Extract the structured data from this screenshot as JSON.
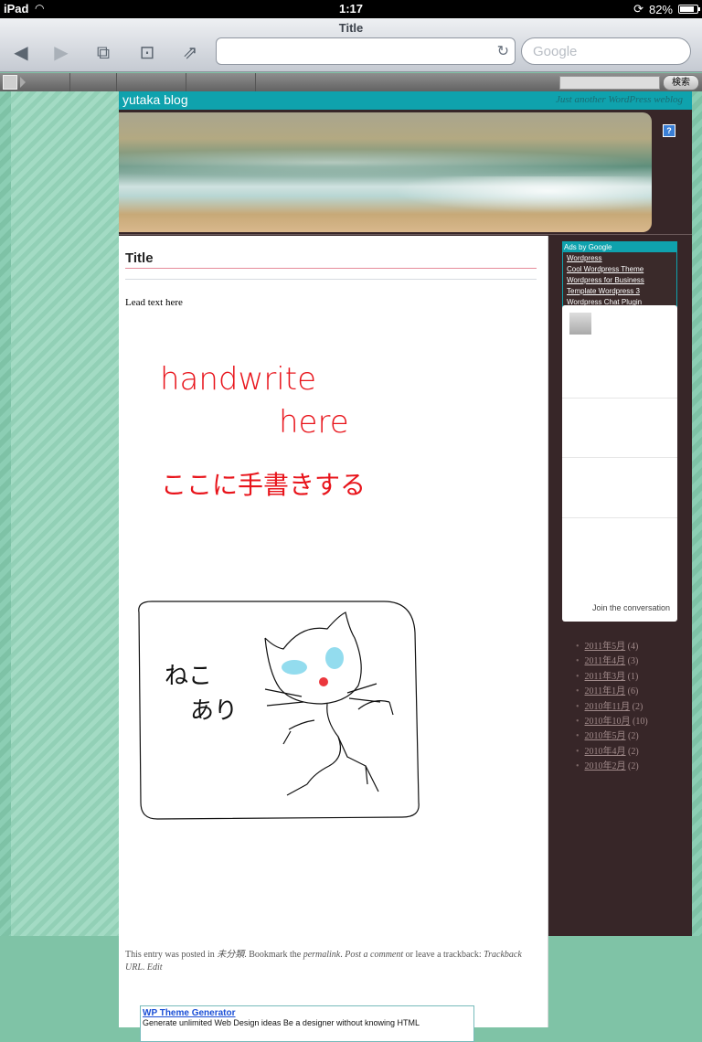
{
  "status_bar": {
    "device": "iPad",
    "time": "1:17",
    "battery": "82%",
    "battery_level": 0.82
  },
  "browser": {
    "title": "Title",
    "url": "",
    "search_placeholder": "Google"
  },
  "admin_bar": {
    "search_button": "検索"
  },
  "blog": {
    "title": "yutaka blog",
    "tagline": "Just another WordPress weblog"
  },
  "post": {
    "title": "Title",
    "lead": "Lead text here",
    "handwriting": {
      "line1": "handwrite",
      "line2": "here",
      "line3": "ここに手書きする",
      "cat_note": [
        "ねこ",
        "あり"
      ]
    },
    "meta": {
      "prefix": "This entry was posted in ",
      "category": "未分類",
      "mid1": ". Bookmark the ",
      "permalink": "permalink",
      "mid2": ". ",
      "post_comment": "Post a comment",
      "mid3": " or leave a trackback: ",
      "trackback": "Trackback URL",
      "mid4": ". ",
      "edit": "Edit"
    }
  },
  "wp_box": {
    "link": "WP Theme Generator",
    "desc": "Generate unlimited Web Design ideas Be a designer without knowing HTML"
  },
  "ads": {
    "header": "Ads by Google",
    "links": [
      "Wordpress",
      "Cool Wordpress Theme",
      "Wordpress for Business",
      "Template Wordpress 3",
      "Wordpress Chat Plugin"
    ]
  },
  "widget": {
    "join": "Join the conversation"
  },
  "archives": [
    {
      "label": "2011年5月",
      "count": "(4)"
    },
    {
      "label": "2011年4月",
      "count": "(3)"
    },
    {
      "label": "2011年3月",
      "count": "(1)"
    },
    {
      "label": "2011年1月",
      "count": "(6)"
    },
    {
      "label": "2010年11月",
      "count": "(2)"
    },
    {
      "label": "2010年10月",
      "count": "(10)"
    },
    {
      "label": "2010年5月",
      "count": "(2)"
    },
    {
      "label": "2010年4月",
      "count": "(2)"
    },
    {
      "label": "2010年2月",
      "count": "(2)"
    }
  ],
  "colors": {
    "accent": "#0fa2ad",
    "sidebar_bg": "#372628",
    "page_bg": "#7fc3a6",
    "ink_red": "#e8141b"
  }
}
